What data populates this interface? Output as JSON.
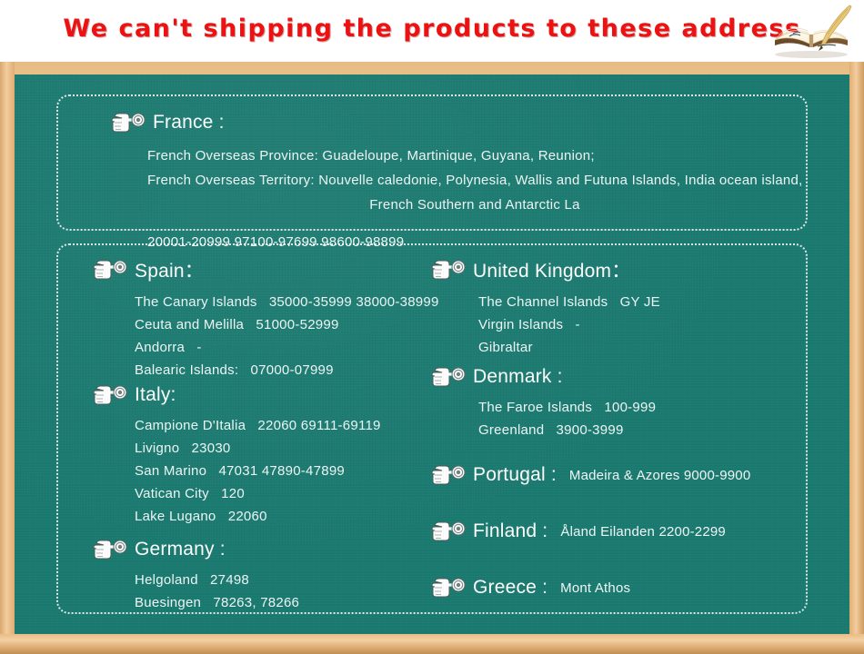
{
  "header": {
    "title": "We can't shipping the products to these address",
    "title_color": "#ee1111",
    "book_icon": "open-book-with-quill-icon"
  },
  "board": {
    "background_color": "#1b7a70",
    "frame_color": "#e8bc84",
    "text_color": "#ffffff",
    "pointer_icon": "pointing-hand-icon"
  },
  "panels": {
    "france": {
      "title": "France :",
      "lines": [
        "French Overseas Province: Guadeloupe, Martinique, Guyana, Reunion;",
        "French Overseas Territory: Nouvelle caledonie, Polynesia, Wallis and Futuna Islands, India ocean island,",
        "French Southern and Antarctic La"
      ],
      "zip_line": "20001-20999 97100-97699 98600-98899"
    },
    "left_column": [
      {
        "title": "Spain：",
        "lines": [
          "The Canary Islands   35000-35999 38000-38999",
          "Ceuta and Melilla   51000-52999",
          "Andorra   -",
          "Balearic Islands:   07000-07999"
        ]
      },
      {
        "title": "Italy:",
        "lines": [
          "Campione D'Italia   22060 69111-69119",
          "Livigno   23030",
          "San Marino   47031 47890-47899",
          "Vatican City   120",
          "Lake Lugano   22060"
        ]
      },
      {
        "title": "Germany :",
        "lines": [
          "Helgoland   27498",
          "Buesingen   78263, 78266"
        ]
      }
    ],
    "right_column": [
      {
        "title": "United Kingdom：",
        "lines": [
          "The Channel Islands   GY JE",
          "Virgin Islands   -",
          "Gibraltar"
        ]
      },
      {
        "title": "Denmark :",
        "lines": [
          "The Faroe Islands   100-999",
          "Greenland   3900-3999"
        ]
      },
      {
        "title": "Portugal :",
        "inline": "Madeira & Azores   9000-9900",
        "lines": []
      },
      {
        "title": "Finland  :",
        "inline": "Åland Eilanden   2200-2299",
        "lines": []
      },
      {
        "title": "Greece :",
        "inline": "Mont Athos",
        "lines": []
      }
    ]
  }
}
